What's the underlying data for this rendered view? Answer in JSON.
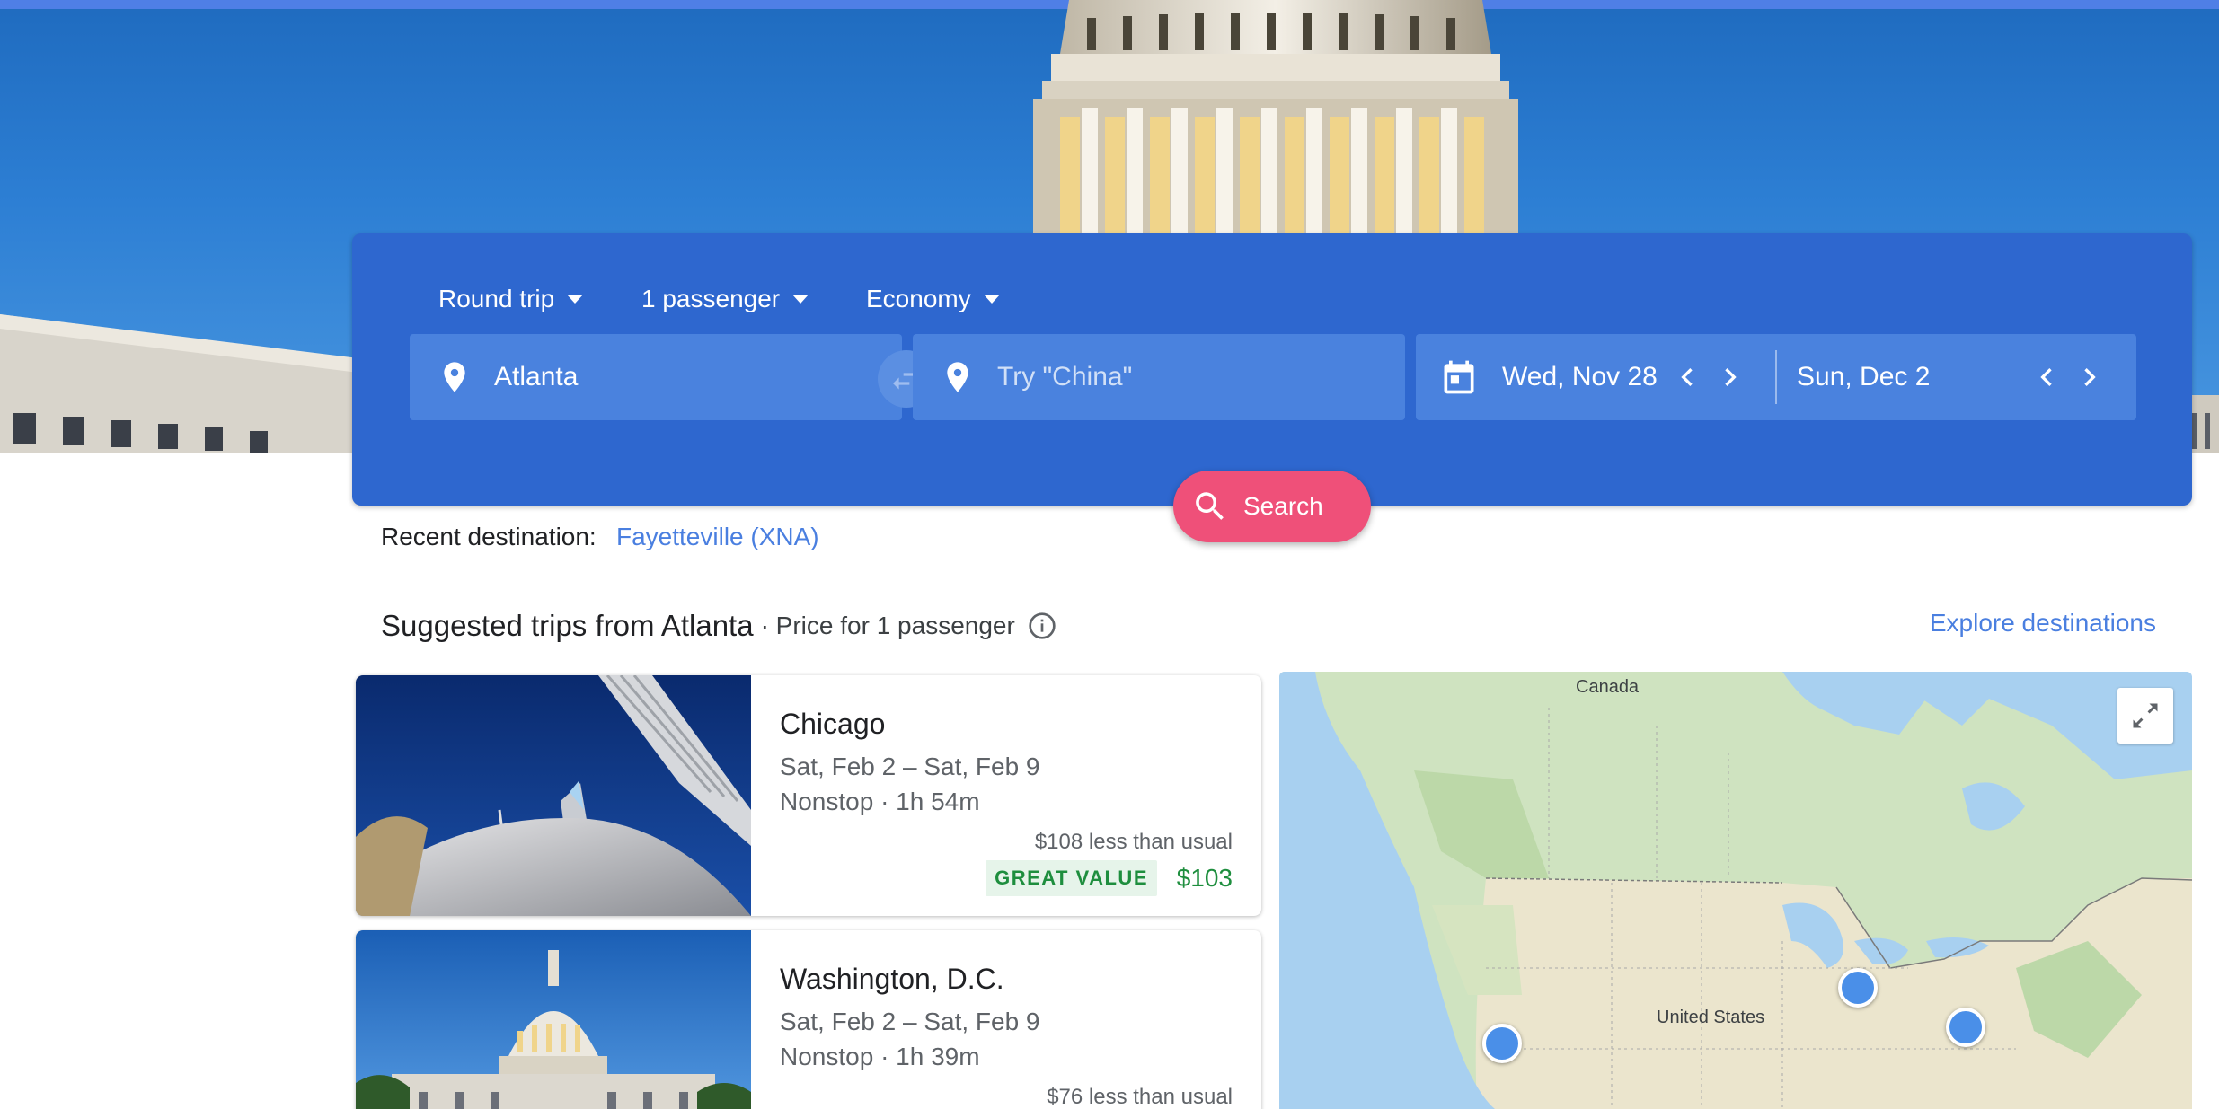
{
  "search": {
    "trip_type": "Round trip",
    "passengers": "1 passenger",
    "cabin_class": "Economy",
    "origin": "Atlanta",
    "destination_placeholder": "Try \"China\"",
    "depart_date": "Wed, Nov 28",
    "return_date": "Sun, Dec 2",
    "search_label": "Search"
  },
  "recent": {
    "label": "Recent destination:",
    "destination": "Fayetteville (XNA)"
  },
  "suggested": {
    "title": "Suggested trips from Atlanta",
    "subtitle": "· Price for 1 passenger",
    "explore_label": "Explore destinations"
  },
  "trips": [
    {
      "city": "Chicago",
      "dates": "Sat, Feb 2 – Sat, Feb 9",
      "flight": "Nonstop · 1h 54m",
      "savings": "$108 less than usual",
      "badge": "GREAT VALUE",
      "price": "$103"
    },
    {
      "city": "Washington, D.C.",
      "dates": "Sat, Feb 2 – Sat, Feb 9",
      "flight": "Nonstop · 1h 39m",
      "savings": "$76 less than usual"
    }
  ],
  "map": {
    "label_canada": "Canada",
    "label_us": "United States"
  },
  "icons": {
    "trip_caret": "chevron-down-icon",
    "origin": "location-pin-icon",
    "swap": "swap-icon",
    "destination": "location-pin-icon",
    "calendar": "calendar-icon",
    "prev": "chevron-left-icon",
    "next": "chevron-right-icon",
    "search": "search-icon",
    "info": "info-icon",
    "expand": "expand-icon"
  },
  "colors": {
    "panel_blue": "#2e67cf",
    "field_blue": "#4a82de",
    "search_pink": "#ef5079",
    "link_blue": "#4a7fe0",
    "value_green": "#1e8e3e"
  }
}
